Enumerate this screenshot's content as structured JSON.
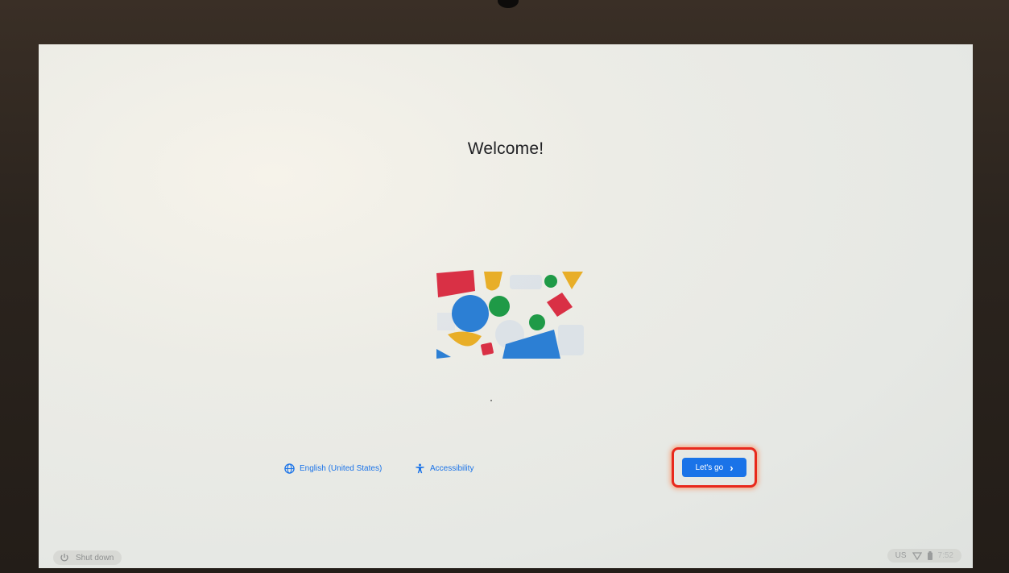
{
  "welcome": {
    "title": "Welcome!"
  },
  "footer": {
    "language_label": "English (United States)",
    "accessibility_label": "Accessibility",
    "next_label": "Let's go"
  },
  "shelf": {
    "shutdown_label": "Shut down",
    "keyboard_layout": "US",
    "clock": "7:52"
  },
  "icons": {
    "language": "globe-icon",
    "accessibility": "accessibility-icon",
    "next": "chevron-right-icon",
    "shutdown": "power-icon",
    "wifi": "wifi-icon",
    "battery": "battery-icon"
  },
  "colors": {
    "accent": "#1a73e8",
    "highlight": "#e8291c",
    "shape_red": "#d93045",
    "shape_yellow": "#e8ae28",
    "shape_green": "#1f9a47",
    "shape_blue": "#2c7fd4"
  }
}
